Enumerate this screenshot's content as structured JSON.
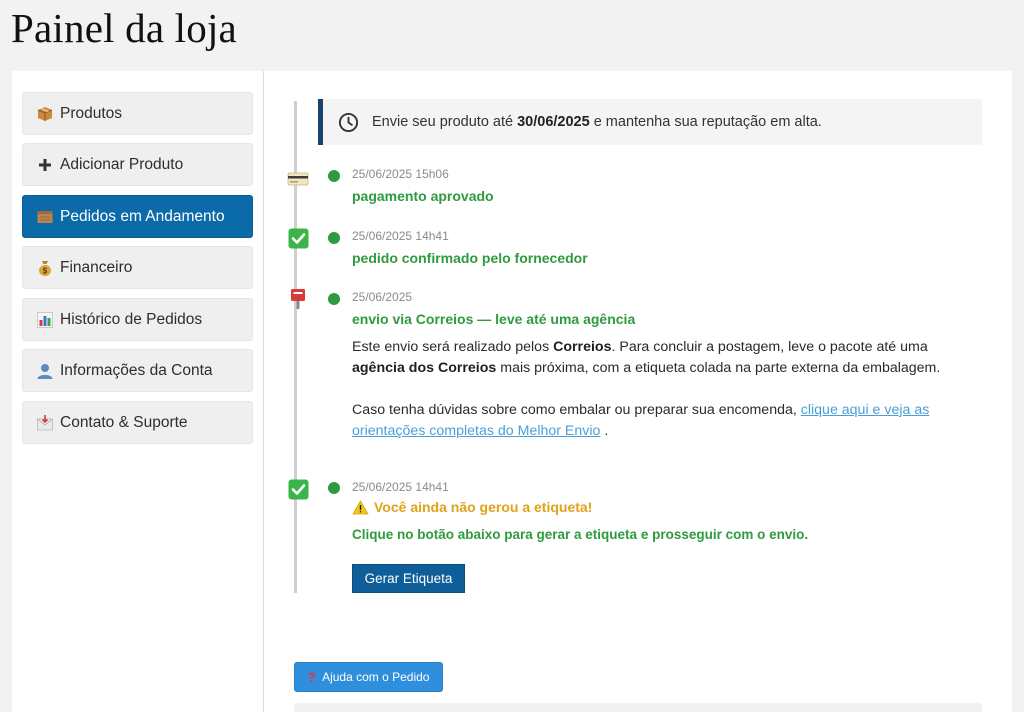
{
  "page": {
    "title": "Painel da loja"
  },
  "sidebar": {
    "items": [
      {
        "label": "Produtos",
        "icon": "package-icon",
        "active": false
      },
      {
        "label": "Adicionar Produto",
        "icon": "plus-icon",
        "active": false
      },
      {
        "label": "Pedidos em Andamento",
        "icon": "box-icon",
        "active": true
      },
      {
        "label": "Financeiro",
        "icon": "money-bag-icon",
        "active": false
      },
      {
        "label": "Histórico de Pedidos",
        "icon": "bar-chart-icon",
        "active": false
      },
      {
        "label": "Informações da Conta",
        "icon": "user-icon",
        "active": false
      },
      {
        "label": "Contato & Suporte",
        "icon": "envelope-icon",
        "active": false
      }
    ],
    "active_color": "#0b6aa8"
  },
  "deadline": {
    "prefix": "Envie seu produto até",
    "date": "30/06/2025",
    "suffix": "e mantenha sua reputação em alta.",
    "icon": "clock-icon"
  },
  "timeline": {
    "accent_color": "#2e9b3e",
    "events": [
      {
        "icon": "credit-card-icon",
        "date": "25/06/2025 15h06",
        "title": "pagamento aprovado"
      },
      {
        "icon": "check-mark-icon",
        "date": "25/06/2025 14h41",
        "title": "pedido confirmado pelo fornecedor"
      },
      {
        "icon": "postbox-icon",
        "date": "25/06/2025",
        "title": "envio via Correios — leve até uma agência",
        "para1_a": "Este envio será realizado pelos",
        "para1_b": "Correios",
        "para1_c": ". Para concluir a postagem, leve o pacote até uma",
        "para1_d": "agência dos Correios",
        "para1_e": "mais próxima, com a etiqueta colada na parte externa da embalagem.",
        "para2_a": "Caso tenha dúvidas sobre como embalar ou preparar sua encomenda,",
        "para2_link": "clique aqui e veja as orientações completas do Melhor Envio",
        "para2_end": "."
      },
      {
        "icon": "check-mark-icon",
        "date": "25/06/2025 14h41",
        "warning": "Você ainda não gerou a etiqueta!",
        "warning_color": "#e0a21a",
        "instruction": "Clique no botão abaixo para gerar a etiqueta e prosseguir com o envio.",
        "button": "Gerar Etiqueta"
      }
    ]
  },
  "help": {
    "label": "Ajuda com o Pedido",
    "icon": "question-mark-icon"
  }
}
